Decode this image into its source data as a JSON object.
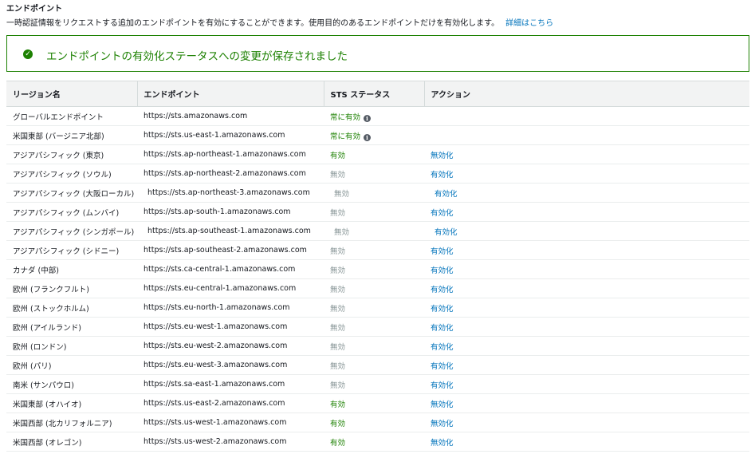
{
  "page": {
    "title": "エンドポイント",
    "description": "一時認証情報をリクエストする追加のエンドポイントを有効にすることができます。使用目的のあるエンドポイントだけを有効化します。",
    "details_link": "詳細はこちら"
  },
  "flash": {
    "message": "エンドポイントの有効化ステータスへの変更が保存されました",
    "icon": "check-circle-icon"
  },
  "table": {
    "columns": [
      "リージョン名",
      "エンドポイント",
      "STS ステータス",
      "アクション"
    ],
    "rows": [
      {
        "region": "グローバルエンドポイント",
        "endpoint": "https://sts.amazonaws.com",
        "status": "常に有効",
        "action": "",
        "status_on": true,
        "info": true
      },
      {
        "region": "米国東部 (バージニア北部)",
        "endpoint": "https://sts.us-east-1.amazonaws.com",
        "status": "常に有効",
        "action": "",
        "status_on": true,
        "info": true
      },
      {
        "region": "アジアパシフィック (東京)",
        "endpoint": "https://sts.ap-northeast-1.amazonaws.com",
        "status": "有効",
        "action": "無効化",
        "status_on": true
      },
      {
        "region": "アジアパシフィック (ソウル)",
        "endpoint": "https://sts.ap-northeast-2.amazonaws.com",
        "status": "無効",
        "action": "有効化",
        "status_on": false
      },
      {
        "region": "アジアパシフィック (大阪ローカル)",
        "endpoint": "https://sts.ap-northeast-3.amazonaws.com",
        "status": "無効",
        "action": "有効化",
        "status_on": false,
        "shift": true
      },
      {
        "region": "アジアパシフィック (ムンバイ)",
        "endpoint": "https://sts.ap-south-1.amazonaws.com",
        "status": "無効",
        "action": "有効化",
        "status_on": false
      },
      {
        "region": "アジアパシフィック (シンガポール)",
        "endpoint": "https://sts.ap-southeast-1.amazonaws.com",
        "status": "無効",
        "action": "有効化",
        "status_on": false,
        "shift": true
      },
      {
        "region": "アジアパシフィック (シドニー)",
        "endpoint": "https://sts.ap-southeast-2.amazonaws.com",
        "status": "無効",
        "action": "有効化",
        "status_on": false
      },
      {
        "region": "カナダ (中部)",
        "endpoint": "https://sts.ca-central-1.amazonaws.com",
        "status": "無効",
        "action": "有効化",
        "status_on": false
      },
      {
        "region": "欧州 (フランクフルト)",
        "endpoint": "https://sts.eu-central-1.amazonaws.com",
        "status": "無効",
        "action": "有効化",
        "status_on": false
      },
      {
        "region": "欧州 (ストックホルム)",
        "endpoint": "https://sts.eu-north-1.amazonaws.com",
        "status": "無効",
        "action": "有効化",
        "status_on": false
      },
      {
        "region": "欧州 (アイルランド)",
        "endpoint": "https://sts.eu-west-1.amazonaws.com",
        "status": "無効",
        "action": "有効化",
        "status_on": false
      },
      {
        "region": "欧州 (ロンドン)",
        "endpoint": "https://sts.eu-west-2.amazonaws.com",
        "status": "無効",
        "action": "有効化",
        "status_on": false
      },
      {
        "region": "欧州 (パリ)",
        "endpoint": "https://sts.eu-west-3.amazonaws.com",
        "status": "無効",
        "action": "有効化",
        "status_on": false
      },
      {
        "region": "南米 (サンパウロ)",
        "endpoint": "https://sts.sa-east-1.amazonaws.com",
        "status": "無効",
        "action": "有効化",
        "status_on": false
      },
      {
        "region": "米国東部 (オハイオ)",
        "endpoint": "https://sts.us-east-2.amazonaws.com",
        "status": "有効",
        "action": "無効化",
        "status_on": true
      },
      {
        "region": "米国西部 (北カリフォルニア)",
        "endpoint": "https://sts.us-west-1.amazonaws.com",
        "status": "有効",
        "action": "無効化",
        "status_on": true
      },
      {
        "region": "米国西部 (オレゴン)",
        "endpoint": "https://sts.us-west-2.amazonaws.com",
        "status": "有効",
        "action": "無効化",
        "status_on": true
      }
    ]
  },
  "colors": {
    "success": "#1d8102",
    "link": "#0073bb",
    "disabled": "#879596",
    "header_bg": "#f2f3f3"
  }
}
